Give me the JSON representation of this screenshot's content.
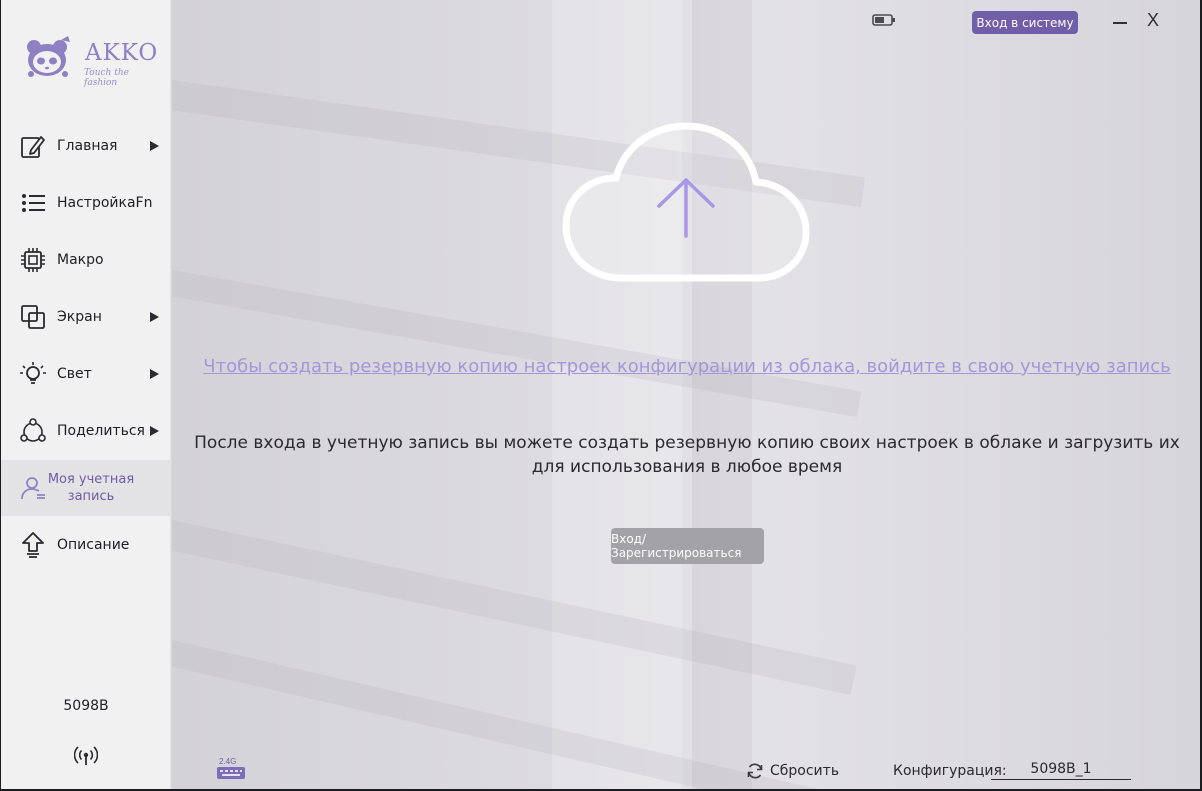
{
  "app": {
    "brand": "AKKO",
    "tagline": "Touch the fashion",
    "accent_color": "#6f5ea8",
    "link_color": "#a595da"
  },
  "sidebar": {
    "items": [
      {
        "label": "Главная",
        "icon": "edit-icon",
        "has_arrow": true
      },
      {
        "label": "НастройкаFn",
        "icon": "list-icon",
        "has_arrow": false
      },
      {
        "label": "Макро",
        "icon": "chip-icon",
        "has_arrow": false
      },
      {
        "label": "Экран",
        "icon": "layers-icon",
        "has_arrow": true
      },
      {
        "label": "Свет",
        "icon": "bulb-icon",
        "has_arrow": true
      },
      {
        "label": "Поделиться",
        "icon": "share-icon",
        "has_arrow": true
      },
      {
        "label": "Моя учетная запись",
        "icon": "user-icon",
        "has_arrow": false,
        "active": true
      },
      {
        "label": "Описание",
        "icon": "upload-arrow-icon",
        "has_arrow": false
      }
    ],
    "device_name": "5098B",
    "connection_icon": "wireless-signal-icon"
  },
  "topbar": {
    "battery_icon": "battery-icon",
    "login_label": "Вход в систему",
    "minimize_icon": "minimize-icon",
    "close_label": "X"
  },
  "main": {
    "cloud_icon": "cloud-upload-icon",
    "backup_link": "Чтобы создать резервную копию настроек конфигурации из облака, войдите в свою учетную запись",
    "info_line1": "После входа в учетную запись вы можете создать резервную копию своих настроек в облаке и загрузить их",
    "info_line2": "для использования в любое время",
    "auth_button": "Вход/Зарегистрироваться"
  },
  "footer": {
    "dongle_label": "2.4G",
    "reset_label": "Сбросить",
    "config_label": "Конфигурация:",
    "config_value": "5098B_1"
  }
}
